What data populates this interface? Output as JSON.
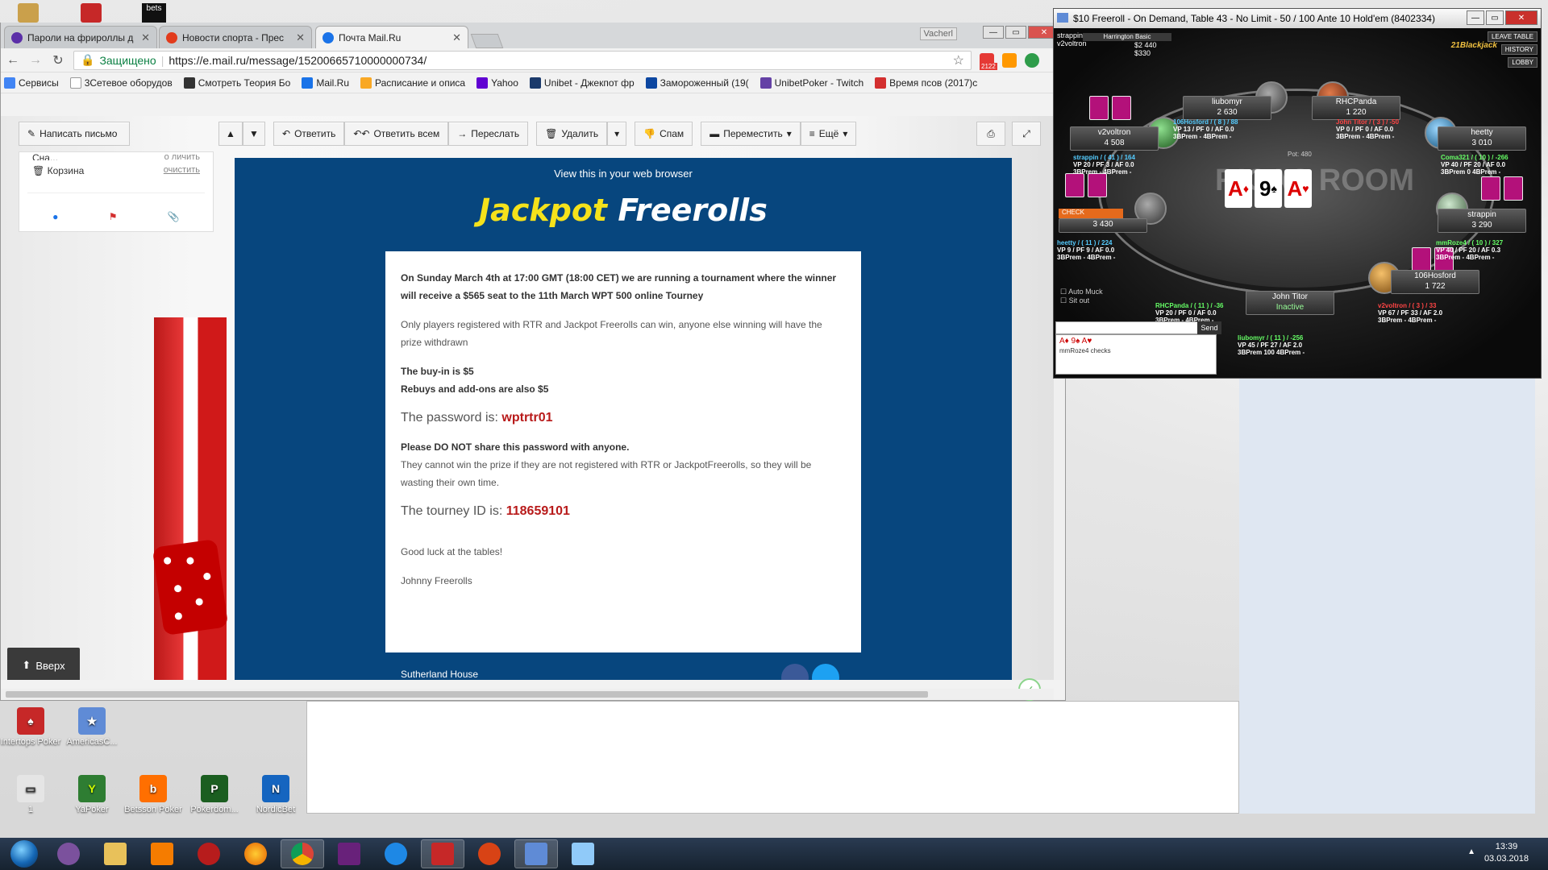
{
  "desktop": {
    "icons": [
      {
        "label": "Intertops Poker",
        "color": "#c62828"
      },
      {
        "label": "AmericasC...",
        "color": "#5f8bd6"
      },
      {
        "label": "1",
        "color": "#e5e5e5"
      },
      {
        "label": "YaPoker",
        "color": "#2e7d32"
      },
      {
        "label": "Betsson Poker",
        "color": "#ff6f00"
      },
      {
        "label": "Pokerdom...",
        "color": "#1b5e20"
      },
      {
        "label": "NordicBet",
        "color": "#1565c0"
      }
    ]
  },
  "browser": {
    "tabs": [
      {
        "title": "Пароли на фрироллы д",
        "color": "#5b2fa8"
      },
      {
        "title": "Новости спорта - Прес",
        "color": "#e23b1c"
      },
      {
        "title": "Почта Mail.Ru",
        "color": "#1a73e8"
      }
    ],
    "user_badge": "Vacherl",
    "secure_label": "Защищено",
    "url": "https://e.mail.ru/message/15200665710000000734/",
    "mail_badge": "2122",
    "bookmarks": [
      "Сервисы",
      "3Сетевое оборудов",
      "Смотреть Теория Бо",
      "Mail.Ru",
      "Расписание и описа",
      "Yahoo",
      "Unibet - Джекпот фр",
      "Замороженный (19(",
      "UnibetPoker - Twitch",
      "Время псов (2017)с"
    ]
  },
  "mail": {
    "compose": "Написать письмо",
    "toolbar": {
      "reply": "Ответить",
      "reply_all": "Ответить всем",
      "forward": "Переслать",
      "delete": "Удалить",
      "spam": "Спам",
      "move": "Переместить",
      "more": "Ещё"
    },
    "sidebar": {
      "partial_item": "Сна...",
      "partial_action": "о личить",
      "trash": "Корзина",
      "trash_action": "очистить"
    },
    "up_button": "Вверх"
  },
  "email": {
    "view_in_browser": "View this in your web browser",
    "logo_part1": "Jackpot",
    "logo_part2": "Freerolls",
    "p1": "On Sunday March 4th at 17:00 GMT (18:00 CET) we are running a tournament where the winner will receive a $565 seat to the 11th March WPT 500 online Tourney",
    "p2": "Only players registered with RTR and Jackpot Freerolls can win, anyone else winning will have the prize withdrawn",
    "p3a": "The buy-in is $5",
    "p3b": "Rebuys and add-ons are also $5",
    "password_label": "The password is:",
    "password_value": "wptrtr01",
    "p4a": "Please DO NOT share this password with anyone.",
    "p4b": "They cannot win the prize if they are not registered with RTR or JackpotFreerolls, so they will be wasting their own time.",
    "tourney_label": "The tourney ID is:",
    "tourney_value": "118659101",
    "p5": "Good luck at the tables!",
    "p6": "Johnny Freerolls",
    "footer_address": "Sutherland House"
  },
  "poker": {
    "title": "$10 Freeroll - On Demand, Table 43 - No Limit - 50 / 100  Ante 10 Hold'em (8402334)",
    "hud_label": "Harrington Basic",
    "top_left": {
      "name": "strappin",
      "sub": "v2voltron",
      "stack": "$2 440",
      "stack2": "$330"
    },
    "brand": "21Blackjack",
    "corner_buttons": [
      "LEAVE TABLE",
      "HISTORY",
      "LOBBY"
    ],
    "pot": "Pot: 480",
    "watermark": "RICAS ROOM",
    "board": [
      {
        "rank": "A",
        "suit": "♦",
        "color": "red"
      },
      {
        "rank": "9",
        "suit": "♠",
        "color": "black"
      },
      {
        "rank": "A",
        "suit": "♥",
        "color": "red"
      }
    ],
    "seats": [
      {
        "name": "liubomyr",
        "chips": "2 630"
      },
      {
        "name": "RHCPanda",
        "chips": "1 220"
      },
      {
        "name": "v2voltron",
        "chips": "4 508"
      },
      {
        "name": "heetty",
        "chips": "3 010"
      },
      {
        "name": "",
        "chips": "3 430"
      },
      {
        "name": "strappin",
        "chips": "3 290"
      },
      {
        "name": "106Hosford",
        "chips": "1 722"
      },
      {
        "name": "John Titor",
        "chips": "Inactive"
      }
    ],
    "huds": [
      {
        "line1": "106Hosford / ( 8 ) / 88",
        "line2": "VP 13 / PF 0 / AF 0.0",
        "line3": "3BPrem - 4BPrem -"
      },
      {
        "line1": "John Titor / ( 3 ) / -50",
        "line2": "VP 0 / PF 0 / AF 0.0",
        "line3": "3BPrem - 4BPrem -"
      },
      {
        "line1": "strappin / ( 41 ) / 164",
        "line2": "VP 20 / PF 3 / AF 0.0",
        "line3": "3BPrem - 4BPrem -"
      },
      {
        "line1": "Coma321 / ( 10 ) / -266",
        "line2": "VP 40 / PF 20 / AF 0.0",
        "line3": "3BPrem 0 4BPrem -"
      },
      {
        "line1": "heetty / ( 11 ) / 224",
        "line2": "VP 9 / PF 9 / AF 0.0",
        "line3": "3BPrem - 4BPrem -"
      },
      {
        "line1": "mmRoze4 / ( 10 ) / 327",
        "line2": "VP 40 / PF 20 / AF 0.3",
        "line3": "3BPrem - 4BPrem -"
      },
      {
        "line1": "RHCPanda / ( 11 ) / -36",
        "line2": "VP 20 / PF 0 / AF 0.0",
        "line3": "3BPrem - 4BPrem -"
      },
      {
        "line1": "v2voltron / ( 3 ) / 33",
        "line2": "VP 67 / PF 33 / AF 2.0",
        "line3": "3BPrem - 4BPrem -"
      },
      {
        "line1": "liubomyr / ( 11 ) / -256",
        "line2": "VP 45 / PF 27 / AF 2.0",
        "line3": "3BPrem 100 4BPrem -"
      }
    ],
    "check_label": "CHECK",
    "auto_muck": "Auto Muck",
    "sit_out": "Sit out",
    "send": "Send",
    "chat_log": "mmRoze4 checks",
    "chat_cards": "A♦ 9♠ A♥"
  },
  "taskbar": {
    "time": "13:39",
    "date": "03.03.2018"
  }
}
